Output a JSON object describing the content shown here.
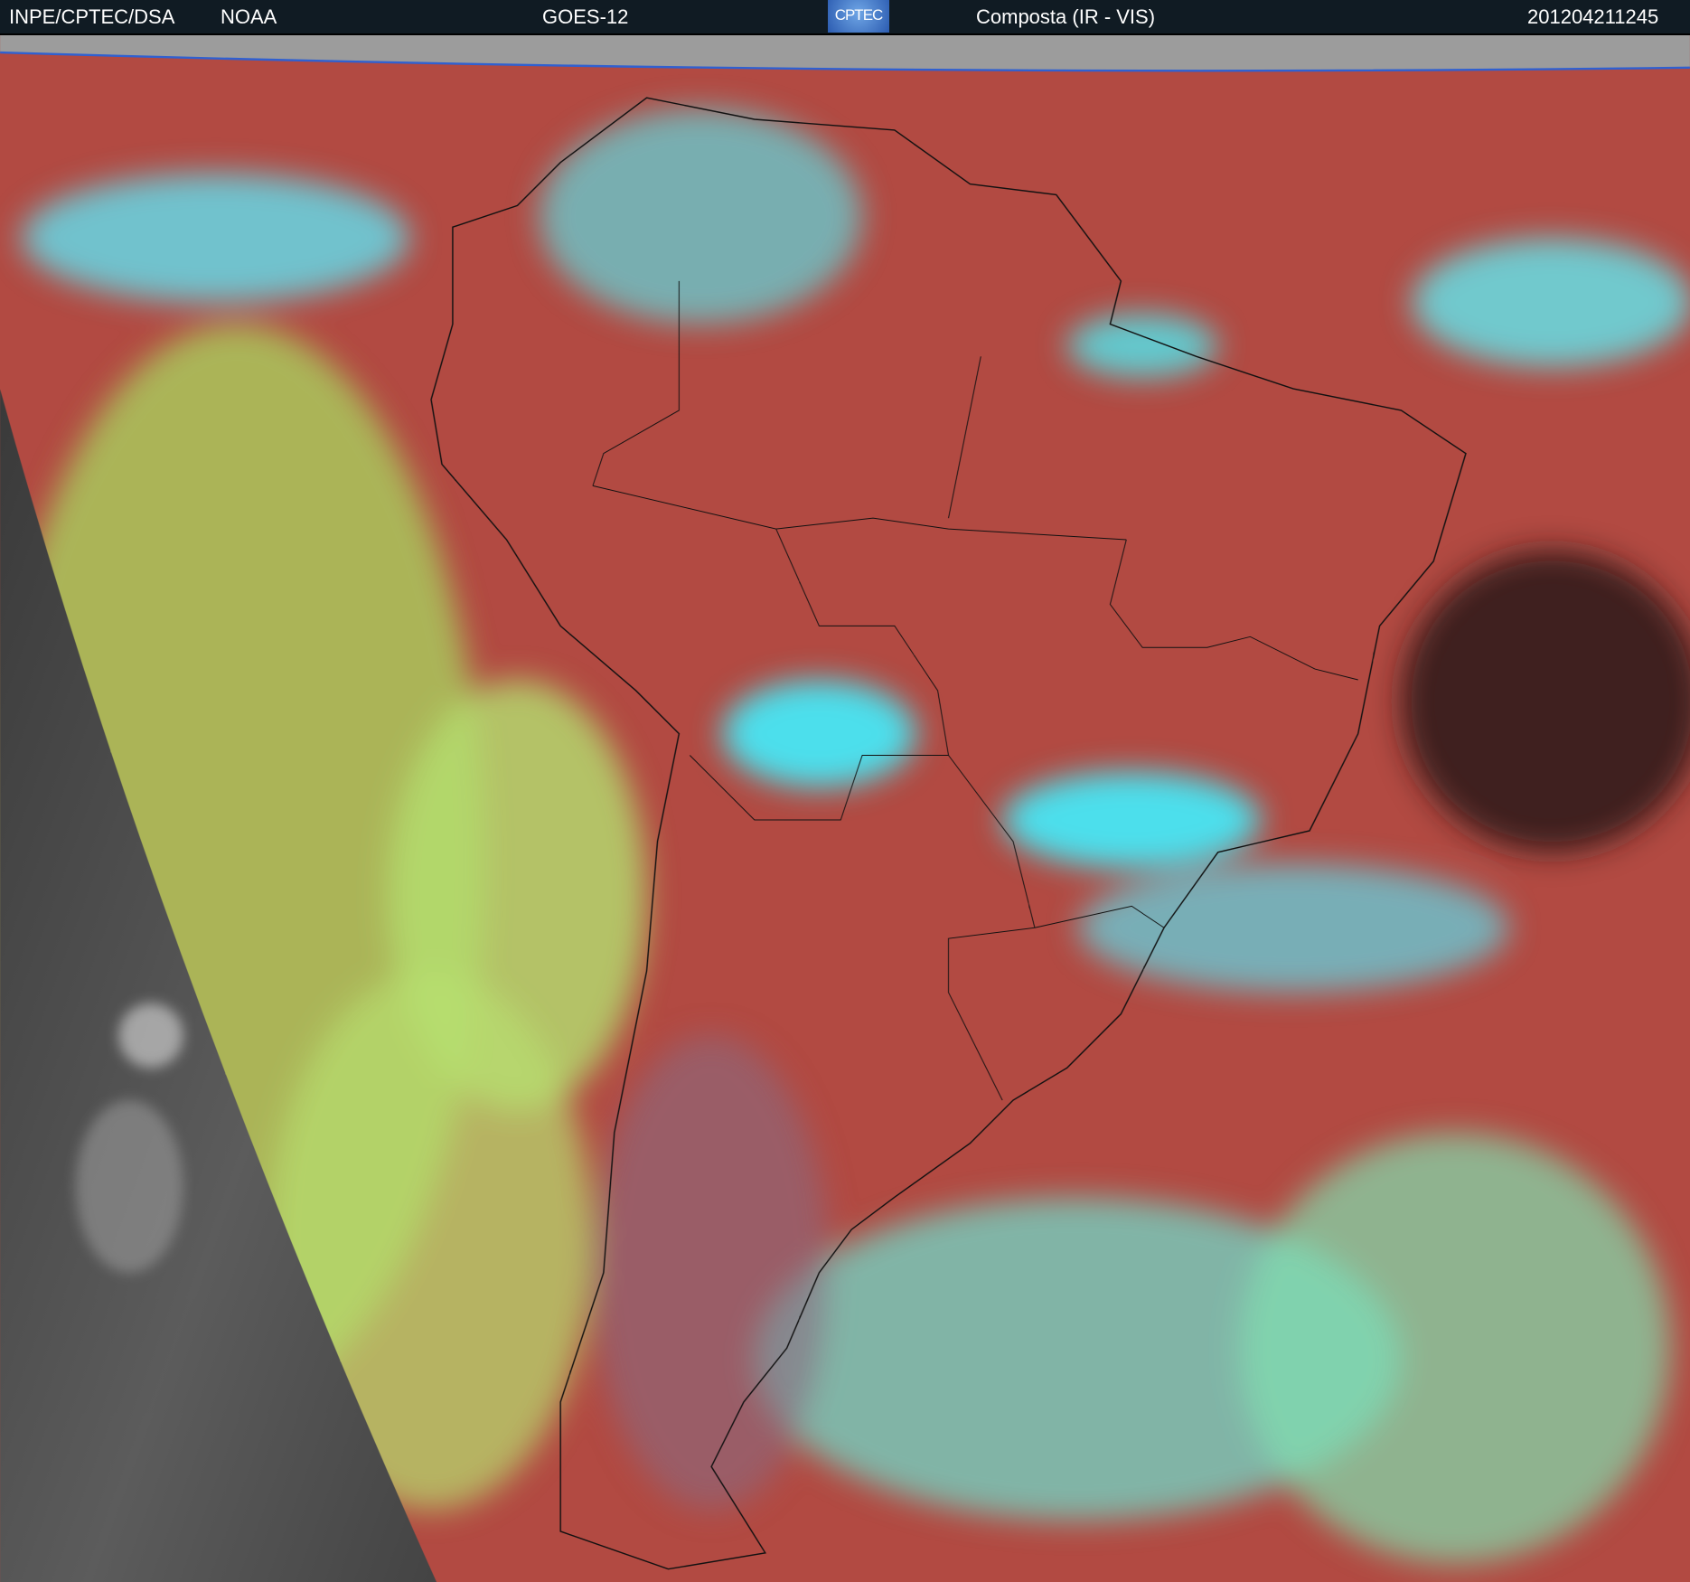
{
  "header": {
    "source": "INPE/CPTEC/DSA",
    "agency": "NOAA",
    "satellite": "GOES-12",
    "logo_text": "CPTEC",
    "product": "Composta (IR - VIS)",
    "timestamp": "201204211245"
  },
  "colors": {
    "header_bg": "#101b23",
    "base_red": "#b24a42",
    "cloud_cyan": "#3ff0ff",
    "cloud_green": "#a8f070",
    "space_gray": "#9a9a9a"
  }
}
